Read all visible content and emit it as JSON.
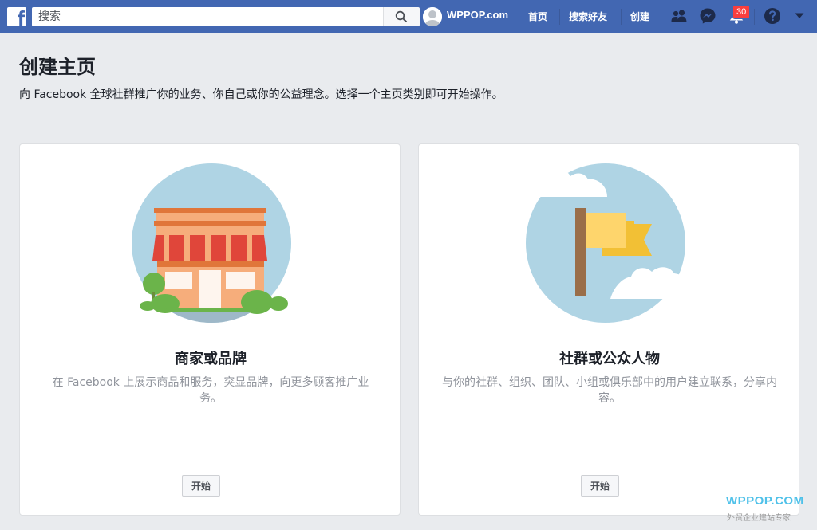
{
  "topbar": {
    "logo": "f",
    "search_placeholder": "搜索",
    "profile_name": "WPPOP.com",
    "nav": [
      "首页",
      "搜索好友",
      "创建"
    ],
    "notification_count": "30",
    "icons": [
      "friends-icon",
      "messenger-icon",
      "bell-icon",
      "help-icon",
      "dropdown-arrow-icon"
    ],
    "accent_color": "#4267b2"
  },
  "page": {
    "title": "创建主页",
    "description": "向 Facebook 全球社群推广你的业务、你自己或你的公益理念。选择一个主页类别即可开始操作。"
  },
  "cards": [
    {
      "title": "商家或品牌",
      "description": "在 Facebook 上展示商品和服务，突显品牌，向更多顾客推广业务。",
      "button": "开始",
      "illustration": "storefront-illustration"
    },
    {
      "title": "社群或公众人物",
      "description": "与你的社群、组织、团队、小组或俱乐部中的用户建立联系，分享内容。",
      "button": "开始",
      "illustration": "flag-illustration"
    }
  ],
  "watermark": {
    "brand": "WPPOP.COM",
    "tagline": "外贸企业建站专家"
  }
}
